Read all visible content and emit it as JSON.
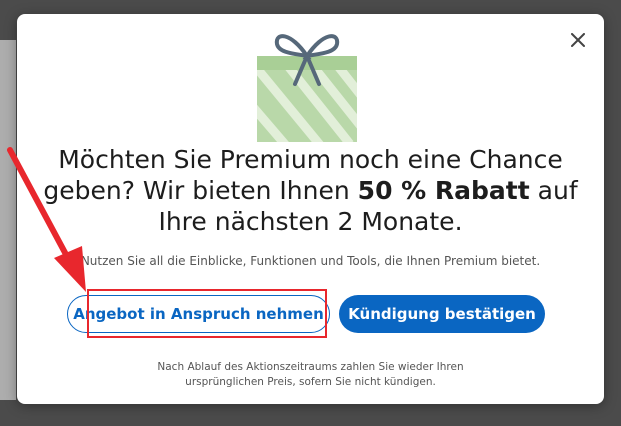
{
  "modal": {
    "headline_part1": "Möchten Sie Premium noch eine Chance geben? Wir bieten Ihnen ",
    "headline_bold": "50 % Rabatt",
    "headline_part2": " auf Ihre nächsten 2 Monate.",
    "subline": "Nutzen Sie all die Einblicke, Funktionen und Tools, die Ihnen Premium bietet.",
    "accept_offer_label": "Angebot in Anspruch nehmen",
    "confirm_cancel_label": "Kündigung bestätigen",
    "footnote_line1": "Nach Ablauf des Aktionszeitraums zahlen Sie wieder Ihren",
    "footnote_line2": "ursprünglichen Preis, sofern Sie nicht kündigen.",
    "close_icon": "close-icon",
    "illustration_icon": "gift-icon"
  },
  "annotation": {
    "arrow_color": "#e8272d",
    "box_color": "#e8272d"
  },
  "colors": {
    "brand": "#0a66c2",
    "gift_box": "#b9d8a9",
    "gift_ribbon": "#56687a"
  }
}
